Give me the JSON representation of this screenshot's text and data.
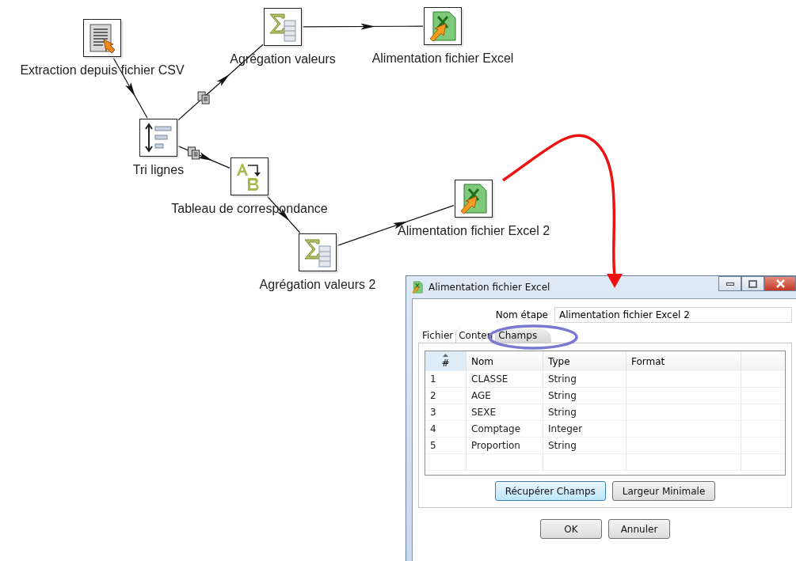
{
  "canvas": {
    "steps": [
      {
        "label": "Extraction depuis fichier CSV",
        "kind": "csv_input"
      },
      {
        "label": "Agrégation valeurs",
        "kind": "group_by"
      },
      {
        "label": "Alimentation fichier Excel",
        "kind": "excel_output"
      },
      {
        "label": "Tri lignes",
        "kind": "sort"
      },
      {
        "label": "Tableau de correspondance",
        "kind": "value_mapper"
      },
      {
        "label": "Agrégation valeurs 2",
        "kind": "group_by"
      },
      {
        "label": "Alimentation fichier Excel 2",
        "kind": "excel_output"
      }
    ],
    "hops": [
      {
        "copies": false
      },
      {
        "copies": true
      },
      {
        "copies": false
      },
      {
        "copies": true
      },
      {
        "copies": false
      },
      {
        "copies": false
      }
    ]
  },
  "dialog": {
    "title": "Alimentation fichier Excel",
    "step_name": {
      "label": "Nom étape",
      "value": "Alimentation fichier Excel 2"
    },
    "tabs": [
      {
        "label": "Fichier",
        "selected": false
      },
      {
        "label": "Conten",
        "selected": false
      },
      {
        "label": "Champs",
        "selected": true
      }
    ],
    "table": {
      "columns": [
        "#",
        "Nom",
        "Type",
        "Format"
      ],
      "rows": [
        {
          "cells": [
            "1",
            "CLASSE",
            "String"
          ]
        },
        {
          "cells": [
            "2",
            "AGE",
            "String"
          ]
        },
        {
          "cells": [
            "3",
            "SEXE",
            "String"
          ]
        },
        {
          "cells": [
            "4",
            "Comptage",
            "Integer"
          ]
        },
        {
          "cells": [
            "5",
            "Proportion",
            "String"
          ]
        }
      ]
    },
    "actions": [
      "Récupérer Champs",
      "Largeur Minimale"
    ],
    "buttons": [
      "OK",
      "Annuler"
    ]
  }
}
